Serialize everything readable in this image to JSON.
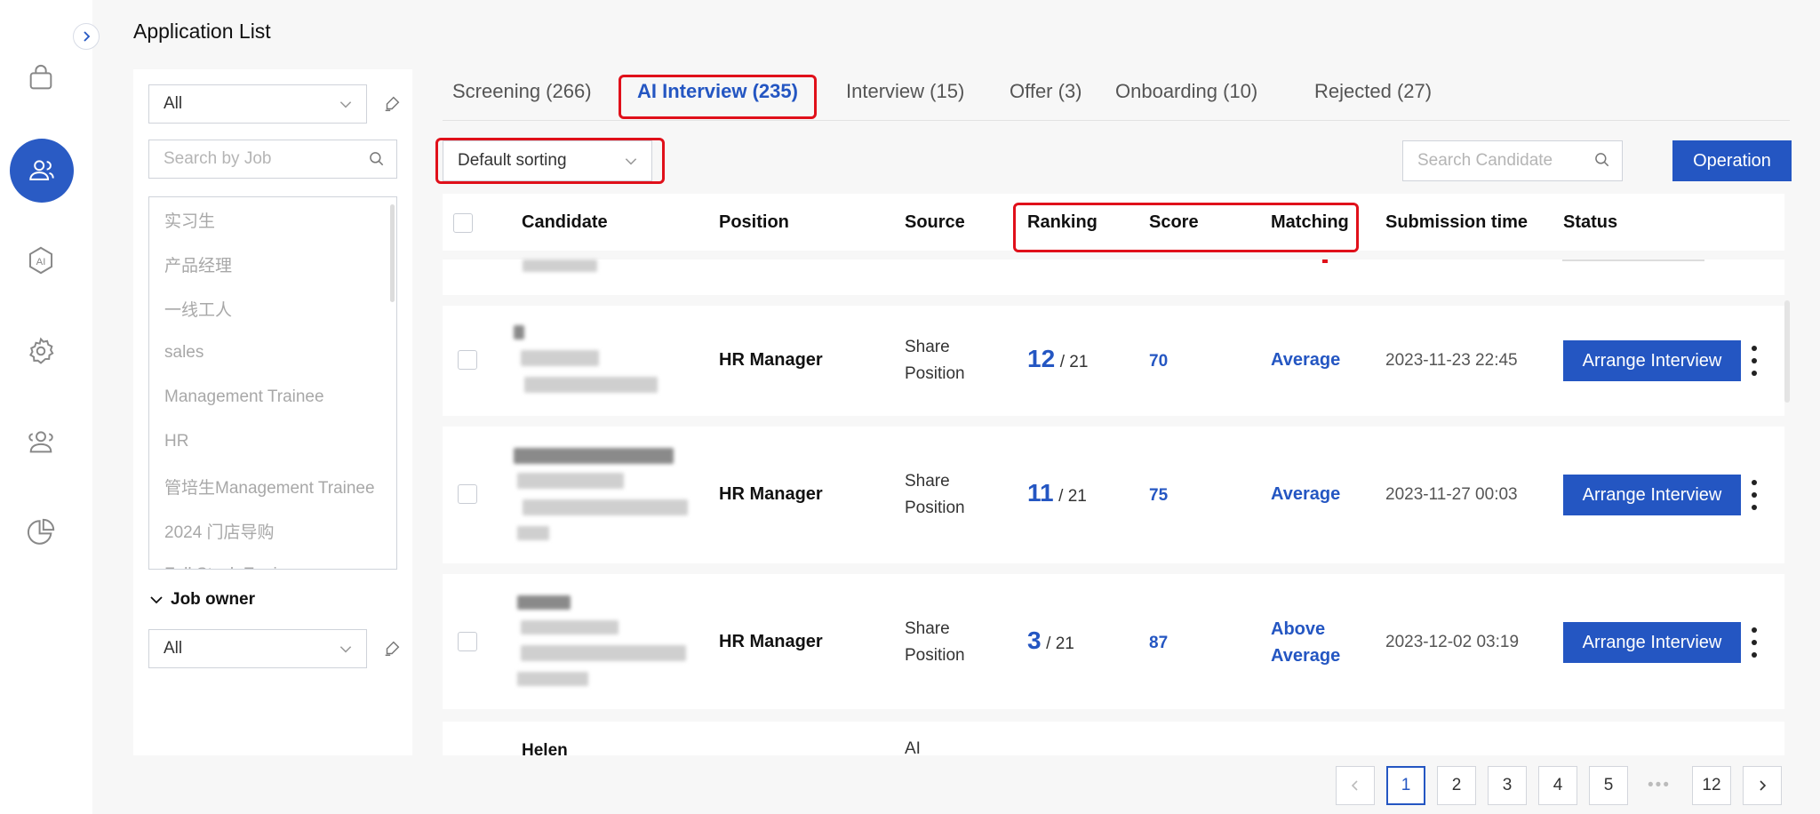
{
  "page": {
    "title": "Application List"
  },
  "rail": {
    "icons": [
      "bag-icon",
      "users-icon",
      "ai-icon",
      "settings-icon",
      "team-icon",
      "pie-chart-icon"
    ],
    "ai_text": "AI"
  },
  "filter": {
    "status_select": "All",
    "job_search_placeholder": "Search by Job",
    "jobs": [
      "实习生",
      "产品经理",
      "一线工人",
      "sales",
      "Management Trainee",
      "HR",
      "管培生Management Trainee",
      "2024 门店导购",
      "Full Stack Engineer"
    ],
    "job_owner_label": "Job owner",
    "job_owner_select": "All"
  },
  "tabs": [
    {
      "label": "Screening (266)"
    },
    {
      "label": "AI Interview (235)"
    },
    {
      "label": "Interview (15)"
    },
    {
      "label": "Offer (3)"
    },
    {
      "label": "Onboarding (10)"
    },
    {
      "label": "Rejected (27)"
    }
  ],
  "toolbar": {
    "sort": "Default sorting",
    "candidate_search_placeholder": "Search Candidate",
    "operation_label": "Operation"
  },
  "table": {
    "headers": {
      "candidate": "Candidate",
      "position": "Position",
      "source": "Source",
      "ranking": "Ranking",
      "score": "Score",
      "matching": "Matching",
      "submission_time": "Submission time",
      "status": "Status"
    },
    "rows": [
      {
        "position": "HR Manager",
        "source_1": "Share",
        "source_2": "Position",
        "rank": "12",
        "rank_of": "/ 21",
        "score": "70",
        "matching_1": "Average",
        "matching_2": "",
        "time": "2023-11-23 22:45",
        "action": "Arrange Interview"
      },
      {
        "position": "HR Manager",
        "source_1": "Share",
        "source_2": "Position",
        "rank": "11",
        "rank_of": "/ 21",
        "score": "75",
        "matching_1": "Average",
        "matching_2": "",
        "time": "2023-11-27 00:03",
        "action": "Arrange Interview"
      },
      {
        "position": "HR Manager",
        "source_1": "Share",
        "source_2": "Position",
        "rank": "3",
        "rank_of": "/ 21",
        "score": "87",
        "matching_1": "Above",
        "matching_2": "Average",
        "time": "2023-12-02 03:19",
        "action": "Arrange Interview"
      }
    ],
    "partial_row": {
      "candidate": "Helen",
      "source": "AI"
    }
  },
  "pagination": {
    "pages": [
      "1",
      "2",
      "3",
      "4",
      "5",
      "12"
    ],
    "current": "1",
    "ellipsis": "•••"
  },
  "colors": {
    "accent": "#2456c2",
    "highlight": "#e0101a"
  }
}
